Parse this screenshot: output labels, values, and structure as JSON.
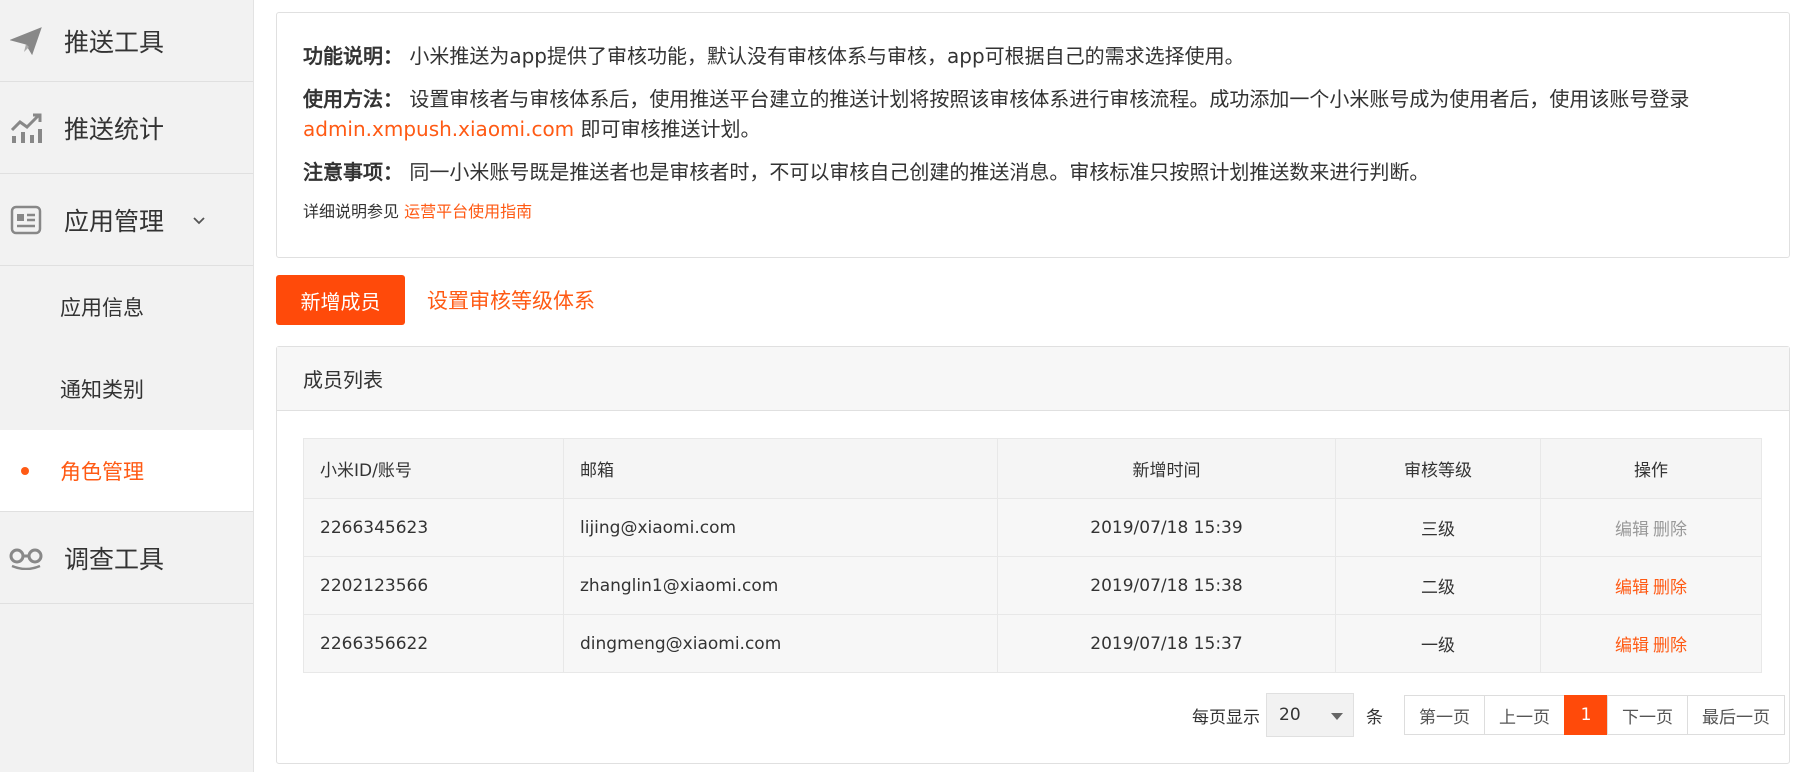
{
  "sidebar": {
    "items": [
      {
        "label": "推送工具",
        "icon": "send-icon"
      },
      {
        "label": "推送统计",
        "icon": "stats-icon"
      },
      {
        "label": "应用管理",
        "icon": "app-card-icon"
      },
      {
        "label": "调查工具",
        "icon": "survey-icon"
      }
    ],
    "sub_items": [
      {
        "label": "应用信息"
      },
      {
        "label": "通知类别"
      },
      {
        "label": "角色管理"
      }
    ]
  },
  "info": {
    "func_title": "功能说明：",
    "func_text": "小米推送为app提供了审核功能，默认没有审核体系与审核，app可根据自己的需求选择使用。",
    "usage_title": "使用方法：",
    "usage_text": "设置审核者与审核体系后，使用推送平台建立的推送计划将按照该审核体系进行审核流程。成功添加一个小米账号成为使用者后，使用该账号登录",
    "usage_link": "admin.xmpush.xiaomi.com",
    "usage_tail": " 即可审核推送计划。",
    "note_title": "注意事项：",
    "note_text": "同一小米账号既是推送者也是审核者时，不可以审核自己创建的推送消息。审核标准只按照计划推送数来进行判断。",
    "detail_prefix": "详细说明参见 ",
    "detail_link": "运营平台使用指南"
  },
  "actions": {
    "add_member": "新增成员",
    "set_level": "设置审核等级体系"
  },
  "panel": {
    "title": "成员列表",
    "columns": [
      "小米ID/账号",
      "邮箱",
      "新增时间",
      "审核等级",
      "操作"
    ],
    "rows": [
      {
        "id": "2266345623",
        "email": "lijing@xiaomi.com",
        "time": "2019/07/18 15:39",
        "level": "三级",
        "edit": "编辑",
        "delete": "删除"
      },
      {
        "id": "2202123566",
        "email": "zhanglin1@xiaomi.com",
        "time": "2019/07/18 15:38",
        "level": "二级",
        "edit": "编辑",
        "delete": "删除"
      },
      {
        "id": "2266356622",
        "email": "dingmeng@xiaomi.com",
        "time": "2019/07/18 15:37",
        "level": "一级",
        "edit": "编辑",
        "delete": "删除"
      }
    ]
  },
  "pager": {
    "per_page_label": "每页显示",
    "per_page_value": "20",
    "unit": "条",
    "first": "第一页",
    "prev": "上一页",
    "current": "1",
    "next": "下一页",
    "last": "最后一页"
  },
  "colors": {
    "accent": "#ff5a14",
    "button": "#ff4a0a"
  }
}
